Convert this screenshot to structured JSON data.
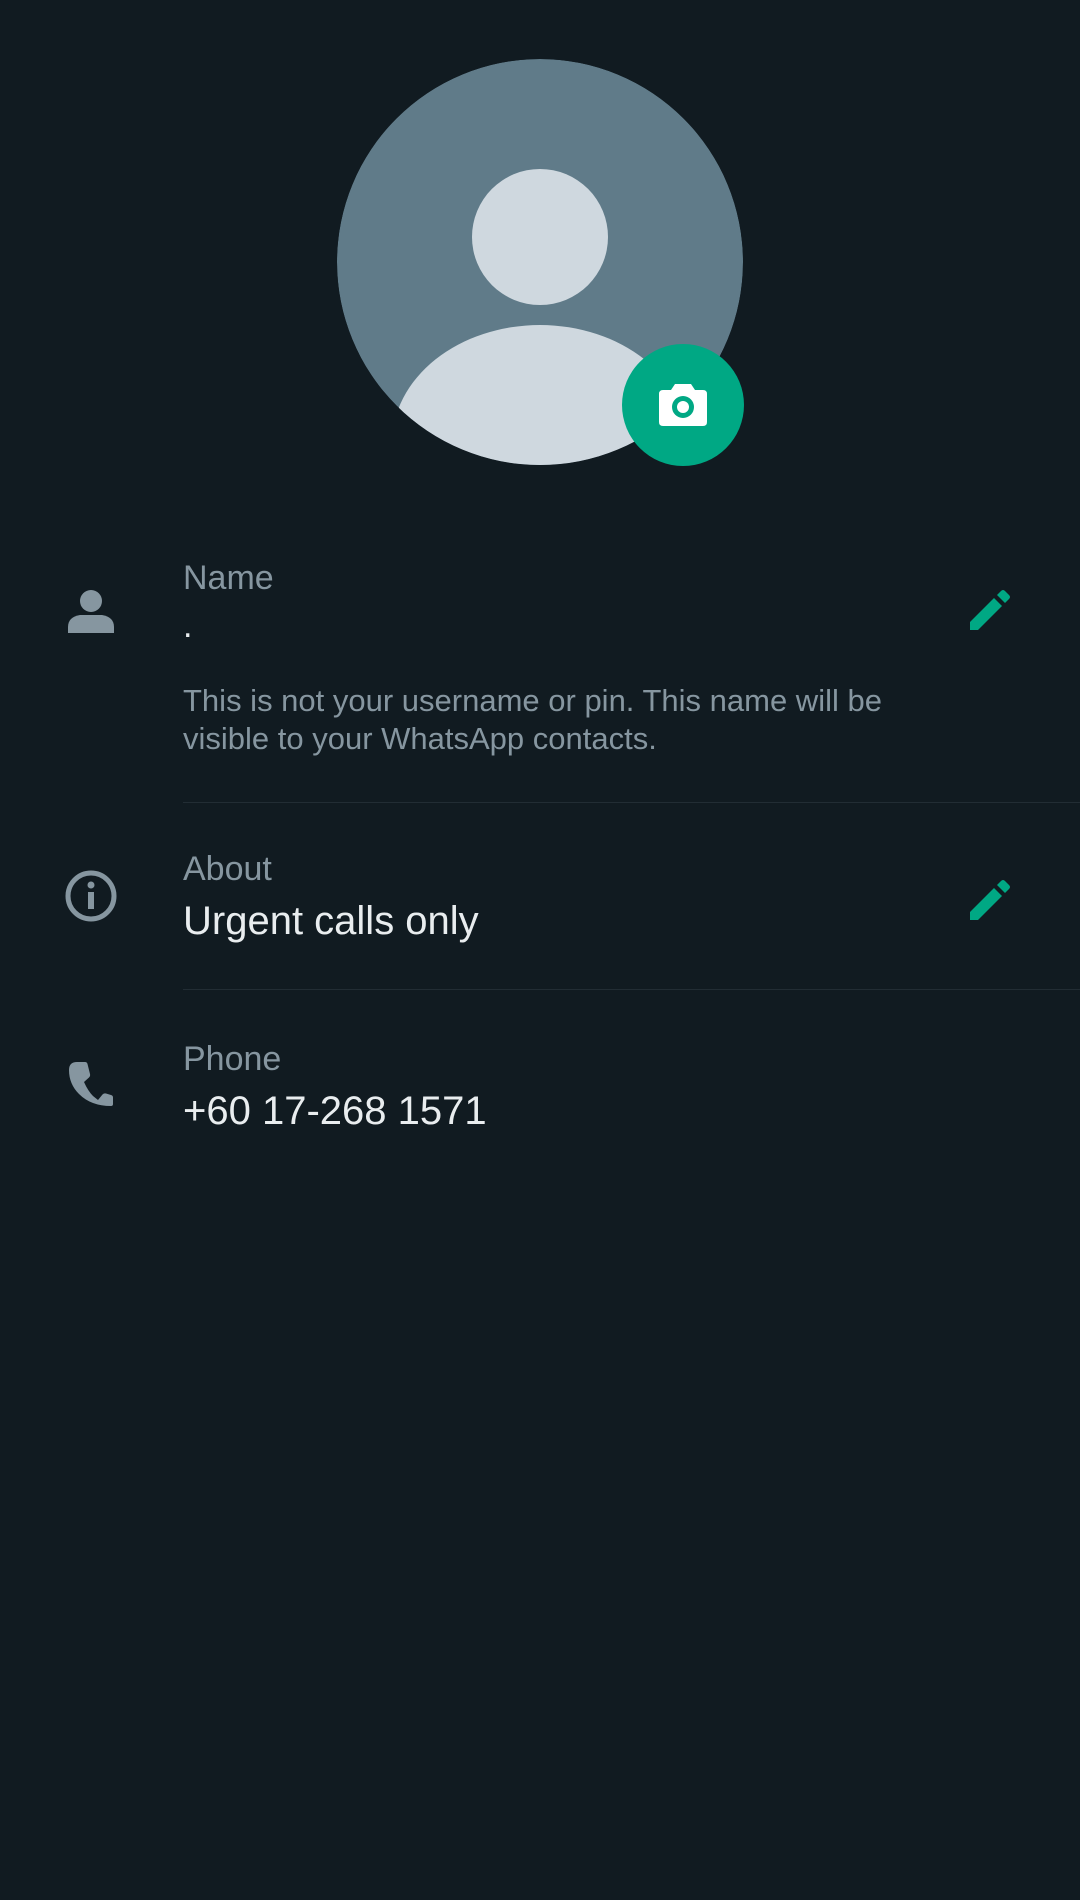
{
  "profile": {
    "name": {
      "label": "Name",
      "value": ".",
      "hint": "This is not your username or pin. This name will be visible to your WhatsApp contacts."
    },
    "about": {
      "label": "About",
      "value": "Urgent calls only"
    },
    "phone": {
      "label": "Phone",
      "value": "+60 17-268 1571"
    }
  },
  "icons": {
    "avatar": "default-avatar-icon",
    "camera": "camera-icon",
    "name": "person-icon",
    "about": "info-icon",
    "phone": "phone-icon",
    "edit": "pencil-icon"
  },
  "colors": {
    "background": "#111b21",
    "accent": "#00a884",
    "label": "#8696a0",
    "text": "#e9edef",
    "avatar_bg": "#607b89",
    "avatar_fg": "#cfd8df"
  }
}
